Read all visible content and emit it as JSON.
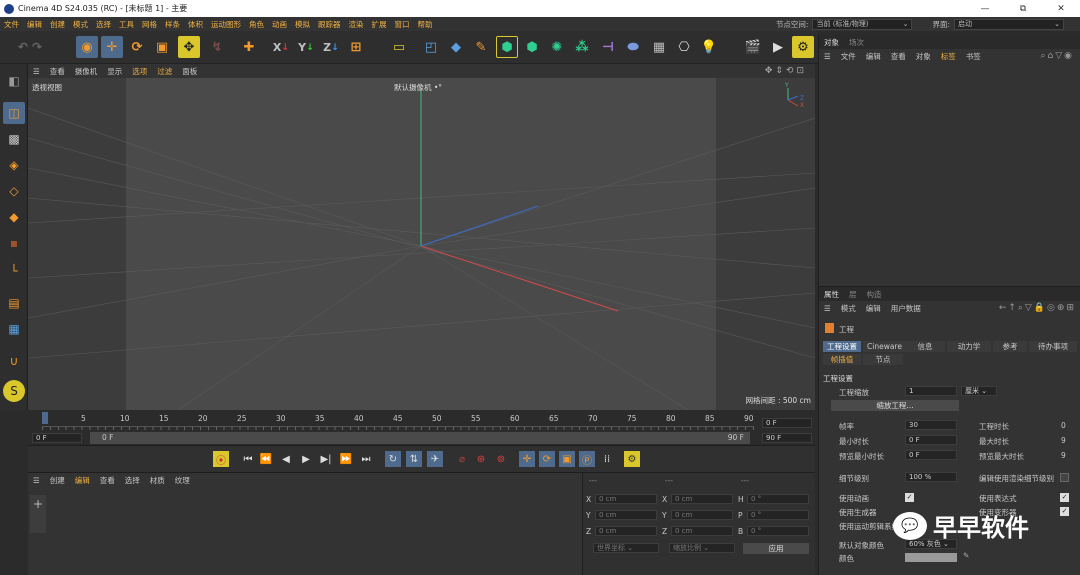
{
  "window": {
    "title": "Cinema 4D S24.035 (RC) - [未标题 1] - 主要",
    "minimize": "—",
    "maximize": "⧉",
    "close": "✕"
  },
  "menu": {
    "items": [
      "文件",
      "编辑",
      "创建",
      "模式",
      "选择",
      "工具",
      "网格",
      "样条",
      "体积",
      "运动图形",
      "角色",
      "动画",
      "模拟",
      "跟踪器",
      "渲染",
      "扩展",
      "窗口",
      "帮助"
    ],
    "node_space_label": "节点空间:",
    "node_space_value": "当前 (标准/物理)",
    "layout_label": "界面:",
    "layout_value": "启动"
  },
  "viewport": {
    "menu": [
      "查看",
      "摄像机",
      "显示",
      "选项",
      "过滤",
      "面板"
    ],
    "view_name": "透视视图",
    "camera": "默认摄像机 •°",
    "grid_spacing": "网格间距 : 500 cm",
    "axis_labels": {
      "y": "Y",
      "z": "Z",
      "x": "X"
    }
  },
  "timeline": {
    "ticks": [
      "0",
      "5",
      "10",
      "15",
      "20",
      "25",
      "30",
      "35",
      "40",
      "45",
      "50",
      "55",
      "60",
      "65",
      "70",
      "75",
      "80",
      "85",
      "90"
    ],
    "current_frame": "0 F",
    "range_start": "0 F",
    "range_end": "90 F",
    "right_frame_top": "0 F",
    "right_frame_bottom": "90 F"
  },
  "material": {
    "menu": [
      "创建",
      "编辑",
      "查看",
      "选择",
      "材质",
      "纹理"
    ]
  },
  "coords": {
    "header": [
      "---",
      "---",
      "---"
    ],
    "rows": [
      {
        "a": "X",
        "av": "0 cm",
        "b": "X",
        "bv": "0 cm",
        "c": "H",
        "cv": "0 °"
      },
      {
        "a": "Y",
        "av": "0 cm",
        "b": "Y",
        "bv": "0 cm",
        "c": "P",
        "cv": "0 °"
      },
      {
        "a": "Z",
        "av": "0 cm",
        "b": "Z",
        "bv": "0 cm",
        "c": "B",
        "cv": "0 °"
      }
    ],
    "mode": "世界坐标",
    "scale": "缩放比例",
    "apply": "应用"
  },
  "objects": {
    "tabs": [
      "对象",
      "场次"
    ],
    "menu": [
      "文件",
      "编辑",
      "查看",
      "对象",
      "标签",
      "书签"
    ]
  },
  "attributes": {
    "tabs": [
      "属性",
      "层",
      "构造"
    ],
    "menu": [
      "模式",
      "编辑",
      "用户数据"
    ],
    "section": "工程",
    "ptabs_row1": [
      "工程设置",
      "Cineware",
      "信息",
      "动力学",
      "参考",
      "待办事项"
    ],
    "ptabs_row2": [
      "帧插值",
      "节点"
    ],
    "group_title": "工程设置",
    "scale_label": "工程缩放",
    "scale_value": "1",
    "scale_unit": "厘米",
    "scale_button": "缩放工程...",
    "fps_label": "帧率",
    "fps_value": "30",
    "project_time_label": "工程时长",
    "project_time_value": "0",
    "min_time_label": "最小时长",
    "min_time_value": "0 F",
    "max_time_label": "最大时长",
    "max_time_value": "9",
    "preview_min_label": "预览最小时长",
    "preview_min_value": "0 F",
    "preview_max_label": "预览最大时长",
    "preview_max_value": "9",
    "lod_label": "细节级别",
    "lod_value": "100 %",
    "render_lod_label": "编辑使用渲染细节级别",
    "use_anim_label": "使用动画",
    "use_expr_label": "使用表达式",
    "use_gen_label": "使用生成器",
    "use_deform_label": "使用变形器",
    "use_motion_label": "使用运动剪辑系统",
    "obj_color_label": "默认对象颜色",
    "obj_color_value": "60% 灰色",
    "color_label": "颜色"
  },
  "watermark": "早早软件"
}
